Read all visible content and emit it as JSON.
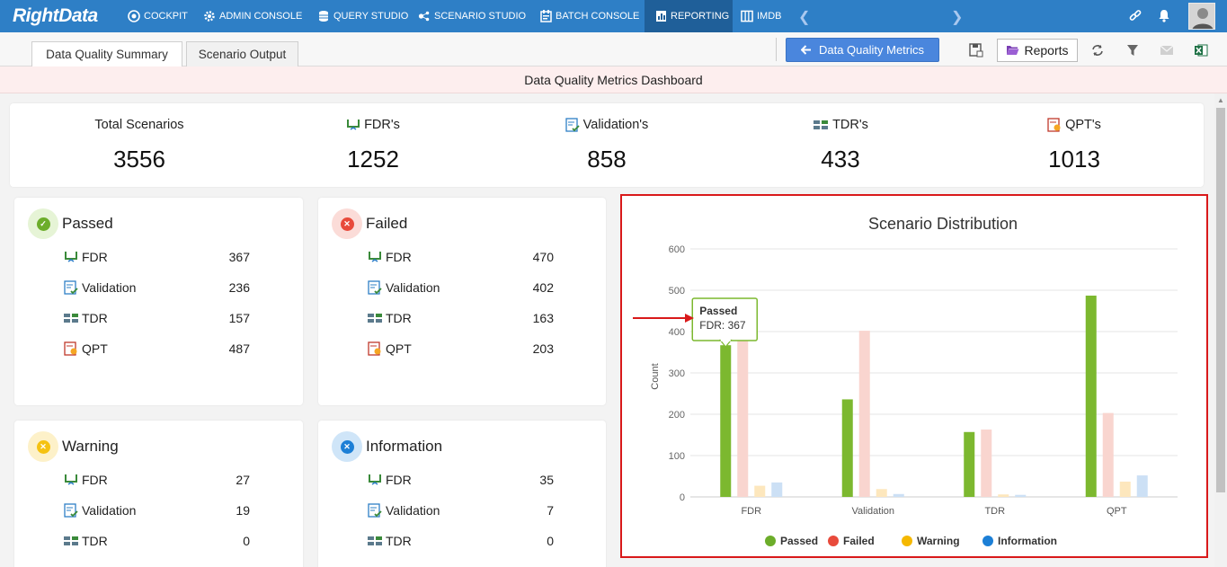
{
  "app": {
    "logo": "RightData"
  },
  "nav": {
    "items": [
      {
        "label": "COCKPIT",
        "icon": "cockpit-icon"
      },
      {
        "label": "ADMIN CONSOLE",
        "icon": "gear-icon"
      },
      {
        "label": "QUERY STUDIO",
        "icon": "database-icon"
      },
      {
        "label": "SCENARIO STUDIO",
        "icon": "scenario-icon"
      },
      {
        "label": "BATCH CONSOLE",
        "icon": "batch-icon"
      },
      {
        "label": "REPORTING",
        "icon": "report-icon",
        "active": true
      },
      {
        "label": "IMDB",
        "icon": "imdb-icon"
      }
    ]
  },
  "tabs": [
    {
      "label": "Data Quality Summary",
      "active": true
    },
    {
      "label": "Scenario Output",
      "active": false
    }
  ],
  "toolbar": {
    "dqm_label": "Data Quality Metrics",
    "reports_label": "Reports"
  },
  "dashboard": {
    "title": "Data Quality Metrics Dashboard"
  },
  "stats": [
    {
      "label": "Total Scenarios",
      "value": "3556",
      "icon": ""
    },
    {
      "label": "FDR's",
      "value": "1252",
      "icon": "fdr-icon"
    },
    {
      "label": "Validation's",
      "value": "858",
      "icon": "validation-icon"
    },
    {
      "label": "TDR's",
      "value": "433",
      "icon": "tdr-icon"
    },
    {
      "label": "QPT's",
      "value": "1013",
      "icon": "qpt-icon"
    }
  ],
  "cards": {
    "passed": {
      "title": "Passed",
      "color": "#8bc34a",
      "bg": "#e6f4d6",
      "rows": [
        {
          "label": "FDR",
          "value": "367"
        },
        {
          "label": "Validation",
          "value": "236"
        },
        {
          "label": "TDR",
          "value": "157"
        },
        {
          "label": "QPT",
          "value": "487"
        }
      ]
    },
    "failed": {
      "title": "Failed",
      "color": "#f05545",
      "bg": "#fbdcd8",
      "rows": [
        {
          "label": "FDR",
          "value": "470"
        },
        {
          "label": "Validation",
          "value": "402"
        },
        {
          "label": "TDR",
          "value": "163"
        },
        {
          "label": "QPT",
          "value": "203"
        }
      ]
    },
    "warning": {
      "title": "Warning",
      "color": "#f5c211",
      "bg": "#fdf1c9",
      "rows": [
        {
          "label": "FDR",
          "value": "27"
        },
        {
          "label": "Validation",
          "value": "19"
        },
        {
          "label": "TDR",
          "value": "0"
        }
      ]
    },
    "information": {
      "title": "Information",
      "color": "#1c7fd6",
      "bg": "#cfe5f8",
      "rows": [
        {
          "label": "FDR",
          "value": "35"
        },
        {
          "label": "Validation",
          "value": "7"
        },
        {
          "label": "TDR",
          "value": "0"
        }
      ]
    }
  },
  "chart_data": {
    "type": "bar",
    "title": "Scenario Distribution",
    "xlabel": "",
    "ylabel": "Count",
    "ylim": [
      0,
      600
    ],
    "yticks": [
      0,
      100,
      200,
      300,
      400,
      500,
      600
    ],
    "categories": [
      "FDR",
      "Validation",
      "TDR",
      "QPT"
    ],
    "series": [
      {
        "name": "Passed",
        "color": "#7cb82f",
        "values": [
          367,
          236,
          157,
          487
        ]
      },
      {
        "name": "Failed",
        "color": "#f9d5cf",
        "values": [
          470,
          402,
          163,
          203
        ]
      },
      {
        "name": "Warning",
        "color": "#fde7bd",
        "values": [
          27,
          19,
          6,
          37
        ]
      },
      {
        "name": "Information",
        "color": "#cce0f5",
        "values": [
          35,
          7,
          5,
          52
        ]
      }
    ],
    "legend_colors": [
      "#6cad2a",
      "#e84a3b",
      "#f5b800",
      "#1c7fd6"
    ],
    "legend_position": "bottom",
    "grid": true,
    "tooltip": {
      "title": "Passed",
      "text": "FDR: 367"
    }
  }
}
